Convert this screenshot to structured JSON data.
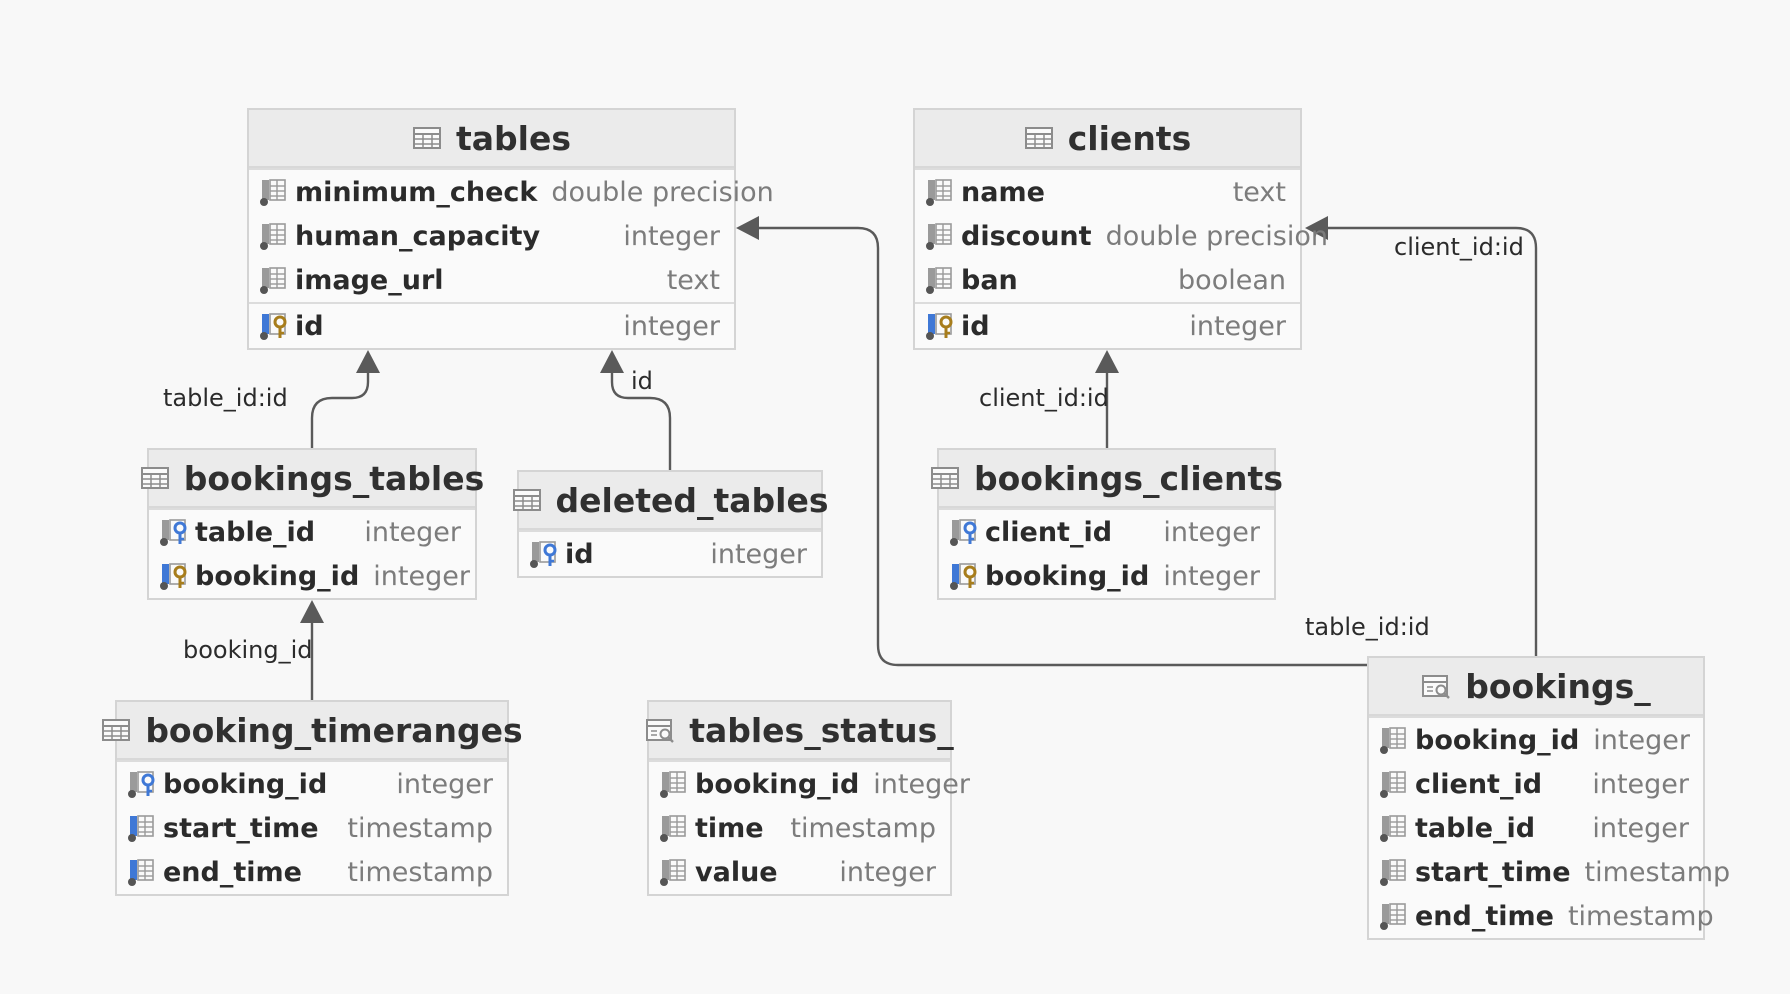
{
  "colors": {
    "background": "#f8f8f8",
    "header": "#ebebeb",
    "line": "#5a5a5a",
    "key_blue": "#3f78d6",
    "key_gold": "#a77d1c"
  },
  "entities": {
    "tables": {
      "title": "tables",
      "icon": "table-icon",
      "columns": [
        {
          "name": "minimum_check",
          "type": "double precision",
          "icon": "column-icon"
        },
        {
          "name": "human_capacity",
          "type": "integer",
          "icon": "column-icon"
        },
        {
          "name": "image_url",
          "type": "text",
          "icon": "column-icon"
        }
      ],
      "keys": [
        {
          "name": "id",
          "type": "integer",
          "icon": "primary-key-icon"
        }
      ]
    },
    "clients": {
      "title": "clients",
      "icon": "table-icon",
      "columns": [
        {
          "name": "name",
          "type": "text",
          "icon": "column-icon"
        },
        {
          "name": "discount",
          "type": "double precision",
          "icon": "column-icon"
        },
        {
          "name": "ban",
          "type": "boolean",
          "icon": "column-icon"
        }
      ],
      "keys": [
        {
          "name": "id",
          "type": "integer",
          "icon": "primary-key-icon"
        }
      ]
    },
    "bookings_tables": {
      "title": "bookings_tables",
      "icon": "table-icon",
      "keys": [
        {
          "name": "table_id",
          "type": "integer",
          "icon": "foreign-key-icon"
        },
        {
          "name": "booking_id",
          "type": "integer",
          "icon": "primary-key-icon"
        }
      ]
    },
    "deleted_tables": {
      "title": "deleted_tables",
      "icon": "table-icon",
      "keys": [
        {
          "name": "id",
          "type": "integer",
          "icon": "foreign-key-icon"
        }
      ]
    },
    "bookings_clients": {
      "title": "bookings_clients",
      "icon": "table-icon",
      "keys": [
        {
          "name": "client_id",
          "type": "integer",
          "icon": "foreign-key-icon"
        },
        {
          "name": "booking_id",
          "type": "integer",
          "icon": "primary-key-icon"
        }
      ]
    },
    "booking_timeranges": {
      "title": "booking_timeranges",
      "icon": "table-icon",
      "keys": [
        {
          "name": "booking_id",
          "type": "integer",
          "icon": "foreign-key-icon"
        },
        {
          "name": "start_time",
          "type": "timestamp",
          "icon": "indexed-column-icon"
        },
        {
          "name": "end_time",
          "type": "timestamp",
          "icon": "indexed-column-icon"
        }
      ]
    },
    "tables_status": {
      "title": "tables_status_",
      "icon": "view-icon",
      "columns": [
        {
          "name": "booking_id",
          "type": "integer",
          "icon": "column-icon"
        },
        {
          "name": "time",
          "type": "timestamp",
          "icon": "column-icon"
        },
        {
          "name": "value",
          "type": "integer",
          "icon": "column-icon"
        }
      ]
    },
    "bookings_view": {
      "title": "bookings_",
      "icon": "view-icon",
      "columns": [
        {
          "name": "booking_id",
          "type": "integer",
          "icon": "column-icon"
        },
        {
          "name": "client_id",
          "type": "integer",
          "icon": "column-icon"
        },
        {
          "name": "table_id",
          "type": "integer",
          "icon": "column-icon"
        },
        {
          "name": "start_time",
          "type": "timestamp",
          "icon": "column-icon"
        },
        {
          "name": "end_time",
          "type": "timestamp",
          "icon": "column-icon"
        }
      ]
    }
  },
  "relations": [
    {
      "id": "r1",
      "from": "bookings_tables",
      "to": "tables",
      "label": "table_id:id"
    },
    {
      "id": "r2",
      "from": "deleted_tables",
      "to": "tables",
      "label": "id"
    },
    {
      "id": "r3",
      "from": "bookings_clients",
      "to": "clients",
      "label": "client_id:id"
    },
    {
      "id": "r4",
      "from": "booking_timeranges",
      "to": "bookings_tables",
      "label": "booking_id"
    },
    {
      "id": "r5",
      "from": "bookings_view",
      "to": "tables",
      "label": "table_id:id"
    },
    {
      "id": "r6",
      "from": "bookings_view",
      "to": "clients",
      "label": "client_id:id"
    }
  ]
}
